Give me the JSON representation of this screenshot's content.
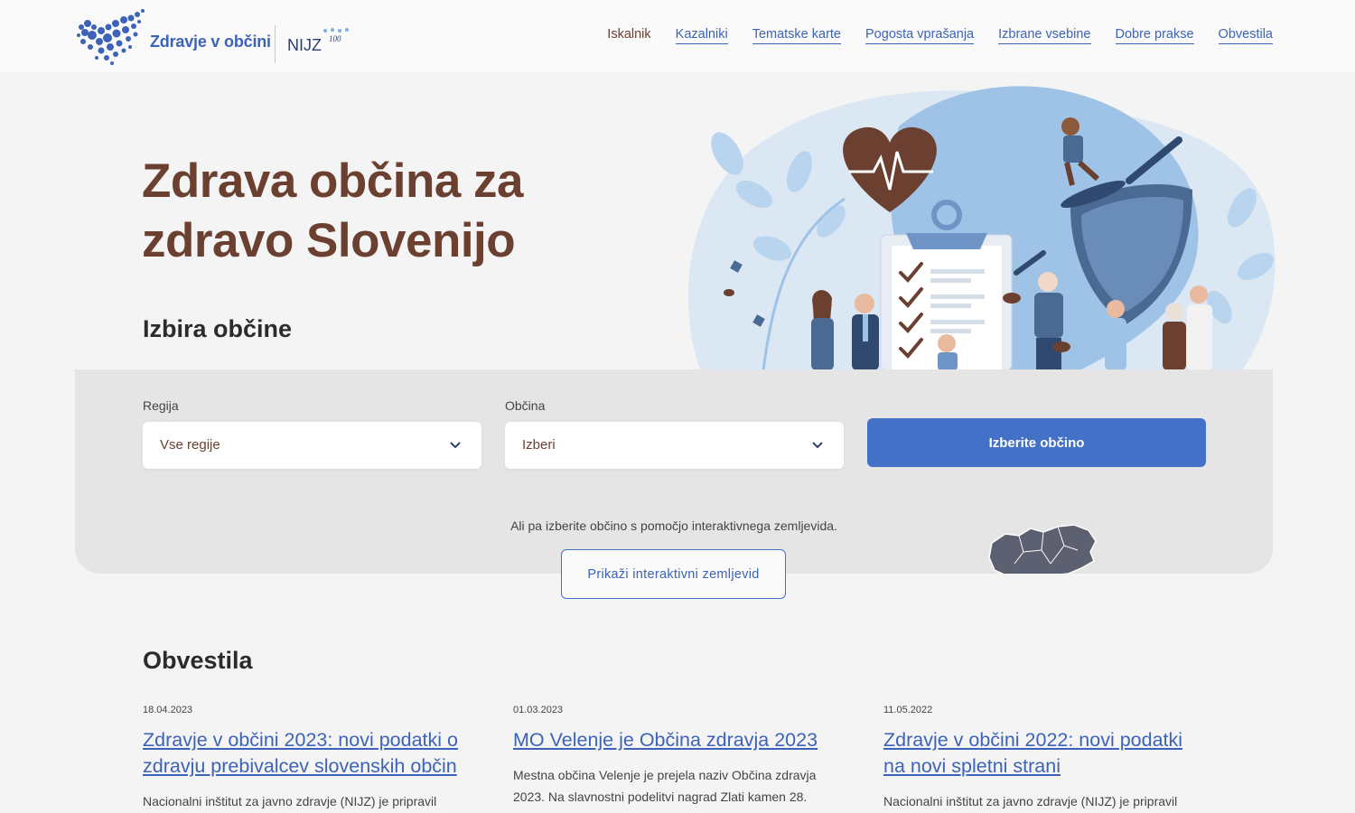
{
  "header": {
    "logo_text": "Zdravje v občini",
    "partner_logo": "NIJZ",
    "partner_badge": "100 let",
    "nav": [
      "Iskalnik",
      "Kazalniki",
      "Tematske karte",
      "Pogosta vprašanja",
      "Izbrane vsebine",
      "Dobre prakse",
      "Obvestila"
    ],
    "active_nav": "Iskalnik"
  },
  "hero": {
    "title": "Zdrava občina za zdravo Slovenijo",
    "section_title": "Izbira občine"
  },
  "selection": {
    "region_label": "Regija",
    "region_value": "Vse regije",
    "municipality_label": "Občina",
    "municipality_value": "Izberi",
    "submit_label": "Izberite občino",
    "map_hint": "Ali pa izberite občino s pomočjo interaktivnega zemljevida.",
    "map_button": "Prikaži interaktivni zemljevid"
  },
  "news": {
    "title": "Obvestila",
    "items": [
      {
        "date": "18.04.2023",
        "title": "Zdravje v občini 2023: novi podatki o zdravju prebivalcev slovenskih občin",
        "excerpt": "Nacionalni inštitut za javno zdravje (NIJZ) je pripravil"
      },
      {
        "date": "01.03.2023",
        "title": "MO Velenje je Občina zdravja 2023",
        "excerpt": "Mestna občina Velenje je prejela naziv Občina zdravja 2023. Na slavnostni podelitvi nagrad Zlati kamen 28."
      },
      {
        "date": "11.05.2022",
        "title": "Zdravje v občini 2022: novi podatki na novi spletni strani",
        "excerpt": "Nacionalni inštitut za javno zdravje (NIJZ) je pripravil"
      }
    ]
  },
  "colors": {
    "brand_blue": "#4471c8",
    "link_blue": "#3d63b8",
    "heading_brown": "#6b4030",
    "panel_gray": "#e5e5e5"
  }
}
